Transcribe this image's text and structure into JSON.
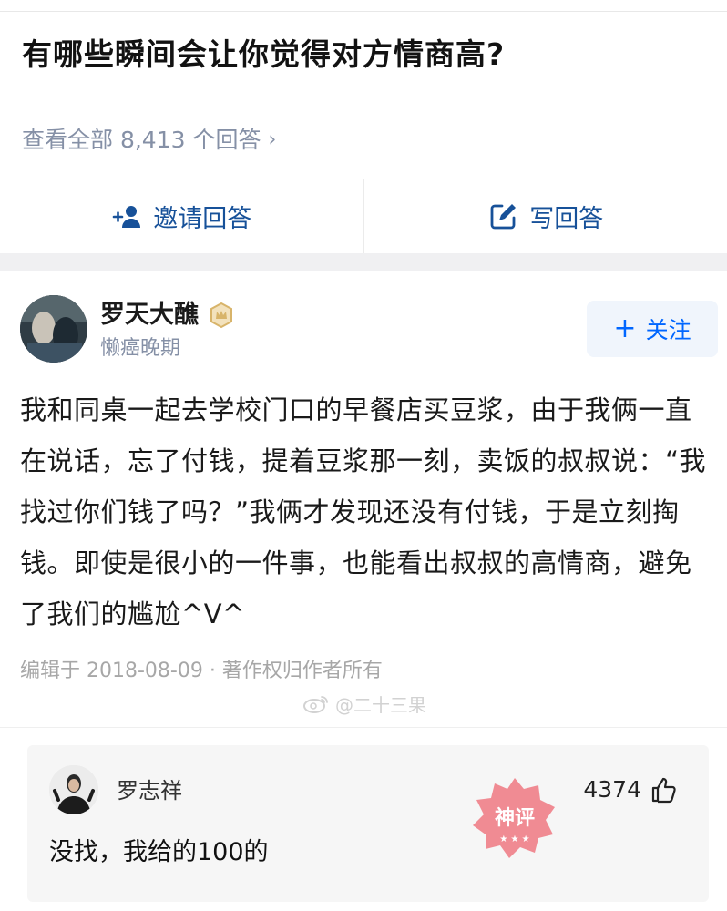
{
  "question": {
    "title": "有哪些瞬间会让你觉得对方情商高?",
    "view_all": "查看全部 8,413 个回答",
    "view_all_chevron": "›"
  },
  "actions": {
    "invite_label": "邀请回答",
    "write_label": "写回答"
  },
  "answer": {
    "author_name": "罗天大醮",
    "author_bio": "懒癌晚期",
    "follow_label": "关注",
    "follow_plus": "+",
    "body": "我和同桌一起去学校门口的早餐店买豆浆，由于我俩一直在说话，忘了付钱，提着豆浆那一刻，卖饭的叔叔说：“我找过你们钱了吗？”我俩才发现还没有付钱，于是立刻掏钱。即使是很小的一件事，也能看出叔叔的高情商，避免了我们的尴尬^V^",
    "meta": "编辑于 2018-08-09 · 著作权归作者所有",
    "watermark": "@二十三果"
  },
  "comment": {
    "name": "罗志祥",
    "likes": "4374",
    "text": "没找，我给的100的",
    "stamp_text": "神评"
  },
  "colors": {
    "link_blue": "#175199",
    "follow_blue": "#0066ff",
    "muted": "#8590a6",
    "badge_gold": "#d8b46a",
    "stamp_red": "#f07f88"
  },
  "icons": {
    "invite": "add-person-icon",
    "write": "edit-icon",
    "badge": "crown-badge-icon",
    "thumb": "thumbs-up-icon",
    "weibo": "weibo-icon"
  }
}
